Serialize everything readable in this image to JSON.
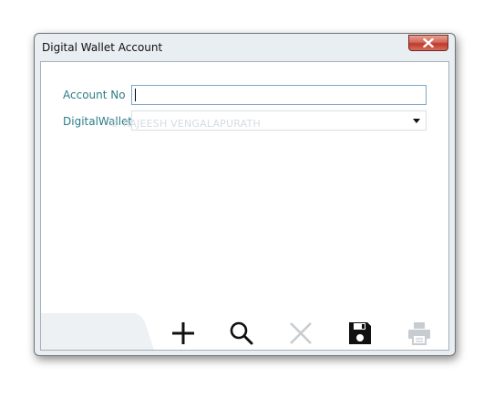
{
  "window": {
    "title": "Digital Wallet Account"
  },
  "form": {
    "account_no_label": "Account No",
    "account_no_value": "",
    "digital_wallet_label": "DigitalWallet",
    "digital_wallet_value": ""
  },
  "watermark": {
    "text": "© RAJEESH VENGALAPURATH"
  },
  "toolbar": {
    "buttons": [
      {
        "name": "add",
        "icon": "plus-icon",
        "enabled": true
      },
      {
        "name": "search",
        "icon": "magnifier-icon",
        "enabled": true
      },
      {
        "name": "delete",
        "icon": "x-icon",
        "enabled": false
      },
      {
        "name": "save",
        "icon": "floppy-disk-icon",
        "enabled": true
      },
      {
        "name": "print",
        "icon": "printer-icon",
        "enabled": false
      }
    ]
  },
  "colors": {
    "label": "#2a7d86",
    "enabled_icon": "#111111",
    "disabled_icon": "#c8ccd0",
    "close_button": "#c0392b"
  }
}
